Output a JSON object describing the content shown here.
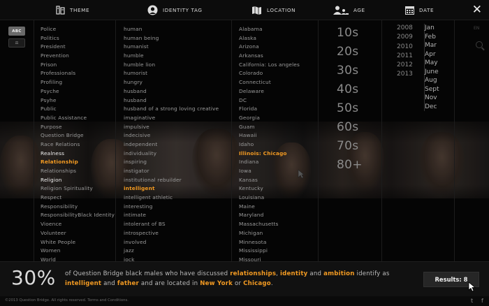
{
  "nav": {
    "theme": "THEME",
    "identity_tag": "IDENTITY TAG",
    "location": "LOCATION",
    "age": "AGE",
    "date": "DATE",
    "close": "✕"
  },
  "sort": {
    "abc": "ABC",
    "scale": "⚖"
  },
  "themes": [
    {
      "label": "Police",
      "state": "normal"
    },
    {
      "label": "Politics",
      "state": "normal"
    },
    {
      "label": "President",
      "state": "normal"
    },
    {
      "label": "Prevention",
      "state": "normal"
    },
    {
      "label": "Prison",
      "state": "normal"
    },
    {
      "label": "Professionals",
      "state": "normal"
    },
    {
      "label": "Profiling",
      "state": "normal"
    },
    {
      "label": "Psyche",
      "state": "normal"
    },
    {
      "label": "Psyhe",
      "state": "normal"
    },
    {
      "label": "Public",
      "state": "normal"
    },
    {
      "label": "Public Assistance",
      "state": "normal"
    },
    {
      "label": "Purpose",
      "state": "normal"
    },
    {
      "label": "Question Bridge",
      "state": "normal"
    },
    {
      "label": "Race Relations",
      "state": "normal"
    },
    {
      "label": "Realness",
      "state": "white"
    },
    {
      "label": "Relationship",
      "state": "orange"
    },
    {
      "label": "Relationships",
      "state": "normal"
    },
    {
      "label": "Religion",
      "state": "white"
    },
    {
      "label": "Religion Spirituality",
      "state": "normal"
    },
    {
      "label": "Respect",
      "state": "normal"
    },
    {
      "label": "Responsibility",
      "state": "normal"
    },
    {
      "label": "ResponsibilityBlack Identity",
      "state": "normal"
    },
    {
      "label": "Vioence",
      "state": "normal"
    },
    {
      "label": "Volunteer",
      "state": "normal"
    },
    {
      "label": "White People",
      "state": "normal"
    },
    {
      "label": "Women",
      "state": "normal"
    },
    {
      "label": "World",
      "state": "normal"
    }
  ],
  "identity_tags": [
    {
      "label": "human",
      "state": "normal"
    },
    {
      "label": "human being",
      "state": "normal"
    },
    {
      "label": "humanist",
      "state": "normal"
    },
    {
      "label": "humble",
      "state": "normal"
    },
    {
      "label": "humble lion",
      "state": "normal"
    },
    {
      "label": "humorist",
      "state": "normal"
    },
    {
      "label": "hungry",
      "state": "normal"
    },
    {
      "label": "husband",
      "state": "normal"
    },
    {
      "label": "husband",
      "state": "normal"
    },
    {
      "label": "husband of a strong loving creative",
      "state": "normal"
    },
    {
      "label": "imaginative",
      "state": "normal"
    },
    {
      "label": "impulsive",
      "state": "normal"
    },
    {
      "label": "indecisive",
      "state": "normal"
    },
    {
      "label": "independent",
      "state": "normal"
    },
    {
      "label": "individuality",
      "state": "normal"
    },
    {
      "label": "inspiring",
      "state": "normal"
    },
    {
      "label": "instigator",
      "state": "normal"
    },
    {
      "label": "institutional rebuilder",
      "state": "normal"
    },
    {
      "label": "intelligent",
      "state": "orange"
    },
    {
      "label": "intelligent athletic",
      "state": "normal"
    },
    {
      "label": "interesting",
      "state": "normal"
    },
    {
      "label": "intimate",
      "state": "normal"
    },
    {
      "label": "intolerant of BS",
      "state": "normal"
    },
    {
      "label": "introspective",
      "state": "normal"
    },
    {
      "label": "involved",
      "state": "normal"
    },
    {
      "label": "jazz",
      "state": "normal"
    },
    {
      "label": "jock",
      "state": "normal"
    }
  ],
  "locations": [
    {
      "label": "Alabama",
      "state": "normal"
    },
    {
      "label": "Alaska",
      "state": "normal"
    },
    {
      "label": "Arizona",
      "state": "normal"
    },
    {
      "label": "Arkansas",
      "state": "normal"
    },
    {
      "label": "California: Los angeles",
      "state": "normal"
    },
    {
      "label": "Colorado",
      "state": "normal"
    },
    {
      "label": "Connecticut",
      "state": "normal"
    },
    {
      "label": "Delaware",
      "state": "normal"
    },
    {
      "label": "DC",
      "state": "normal"
    },
    {
      "label": "Florida",
      "state": "normal"
    },
    {
      "label": "Georgia",
      "state": "normal"
    },
    {
      "label": "Guam",
      "state": "normal"
    },
    {
      "label": "Hawaii",
      "state": "normal"
    },
    {
      "label": "Idaho",
      "state": "normal"
    },
    {
      "label": "Illinois: Chicago",
      "state": "orange"
    },
    {
      "label": "Indiana",
      "state": "normal"
    },
    {
      "label": "Iowa",
      "state": "normal"
    },
    {
      "label": "Kansas",
      "state": "normal"
    },
    {
      "label": "Kentucky",
      "state": "normal"
    },
    {
      "label": "Louisiana",
      "state": "normal"
    },
    {
      "label": "Maine",
      "state": "normal"
    },
    {
      "label": "Maryland",
      "state": "normal"
    },
    {
      "label": "Massachusetts",
      "state": "normal"
    },
    {
      "label": "Michigan",
      "state": "normal"
    },
    {
      "label": "Minnesota",
      "state": "normal"
    },
    {
      "label": "Mississippi",
      "state": "normal"
    },
    {
      "label": "Missouri",
      "state": "normal"
    }
  ],
  "ages": [
    "10s",
    "20s",
    "30s",
    "40s",
    "50s",
    "60s",
    "70s",
    "80+"
  ],
  "years": [
    "2008",
    "2009",
    "2010",
    "2011",
    "2012",
    "2013"
  ],
  "months": [
    "Jan",
    "Feb",
    "Mar",
    "Apr",
    "May",
    "June",
    "Aug",
    "Sept",
    "Nov",
    "Dec"
  ],
  "rail": {
    "lang": "EN"
  },
  "summary": {
    "percent": "30%",
    "t1": "of Question Bridge black males who have discussed ",
    "k1": "relationships",
    "t2": ", ",
    "k2": "identity",
    "t3": " and ",
    "k3": "ambition",
    "t4": " identify as ",
    "k4": "intelligent",
    "t5": " and ",
    "k5": "father",
    "t6": " and are located in ",
    "k6": "New York",
    "t7": " or ",
    "k7": "Chicago",
    "t8": "."
  },
  "results_label": "Results: 8",
  "footer": {
    "copyright": "©2013 Question Bridge. All rights reserved. Terms and Conditions.",
    "twitter": "t",
    "facebook": "f"
  },
  "colors": {
    "accent": "#f29a22",
    "background": "#050505"
  }
}
